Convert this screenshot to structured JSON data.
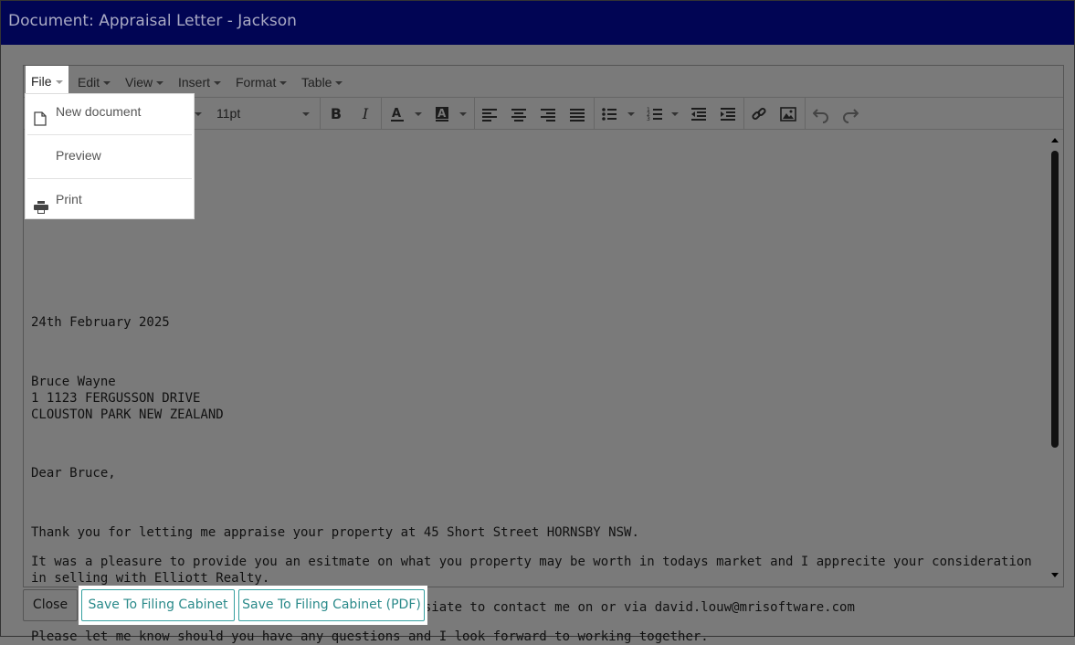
{
  "window": {
    "title": "Document: Appraisal Letter - Jackson"
  },
  "menubar": {
    "items": [
      {
        "label": "File"
      },
      {
        "label": "Edit"
      },
      {
        "label": "View"
      },
      {
        "label": "Insert"
      },
      {
        "label": "Format"
      },
      {
        "label": "Table"
      }
    ]
  },
  "toolbar": {
    "font_size": "11pt",
    "buttons": [
      "bold",
      "italic",
      "text-color",
      "background-color",
      "align-left",
      "align-center",
      "align-right",
      "align-justify",
      "bullet-list",
      "numbered-list",
      "outdent",
      "indent",
      "link",
      "image",
      "undo",
      "redo"
    ]
  },
  "file_menu": {
    "items": [
      {
        "label": "New document",
        "icon": "new-document-icon"
      },
      {
        "label": "Preview",
        "icon": ""
      },
      {
        "label": "Print",
        "icon": "print-icon"
      }
    ]
  },
  "document": {
    "date": "24th February 2025",
    "recipient_name": "Bruce Wayne",
    "address_line1": "1 1123 FERGUSSON DRIVE",
    "address_line2": "CLOUSTON PARK NEW ZEALAND",
    "greeting": "Dear Bruce,",
    "para1": "Thank you for letting me appraise your property at 45 Short Street HORNSBY NSW.",
    "para2": "It was a pleasure to provide you an esitmate on what you property may be worth in todays market and I apprecite your consideration in selling with Elliott Realty.",
    "para3": "Should you like to discuss further, please don;t hesiate to contact me on or via david.louw@mrisoftware.com",
    "para4": "Please let me know should you have any questions and I look forward to working together."
  },
  "footer": {
    "close_label": "Close",
    "save_label": "Save To Filing Cabinet",
    "save_pdf_label": "Save To Filing Cabinet (PDF)"
  },
  "colors": {
    "titlebar_bg": "#010554",
    "overlay": "#7a7a7a",
    "accent": "#2a8a8a"
  }
}
